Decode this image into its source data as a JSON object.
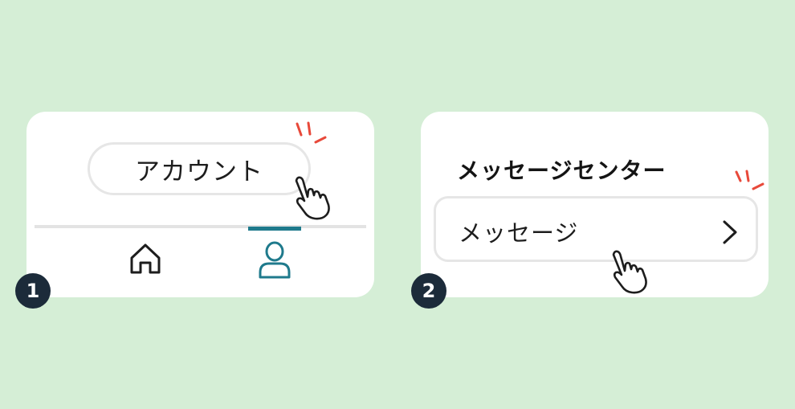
{
  "step1": {
    "badge": "1",
    "button_label": "アカウント",
    "nav": [
      {
        "icon": "home-icon",
        "active": false
      },
      {
        "icon": "person-icon",
        "active": true
      }
    ]
  },
  "step2": {
    "badge": "2",
    "section_title": "メッセージセンター",
    "row_label": "メッセージ",
    "row_icon": "chevron-right-icon"
  },
  "colors": {
    "background": "#d5eed6",
    "panel": "#ffffff",
    "accent": "#1f7a8c",
    "badge": "#1c2b3a",
    "tap_burst": "#e8493a"
  }
}
